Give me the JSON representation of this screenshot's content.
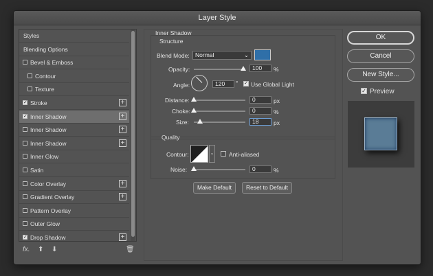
{
  "dialog": {
    "title": "Layer Style"
  },
  "sidebar": {
    "items": [
      {
        "label": "Styles",
        "checkbox": false,
        "checked": false,
        "plus": false,
        "indent": false,
        "selected": false
      },
      {
        "label": "Blending Options",
        "checkbox": false,
        "checked": false,
        "plus": false,
        "indent": false,
        "selected": false
      },
      {
        "label": "Bevel & Emboss",
        "checkbox": true,
        "checked": false,
        "plus": false,
        "indent": false,
        "selected": false
      },
      {
        "label": "Contour",
        "checkbox": true,
        "checked": false,
        "plus": false,
        "indent": true,
        "selected": false
      },
      {
        "label": "Texture",
        "checkbox": true,
        "checked": false,
        "plus": false,
        "indent": true,
        "selected": false
      },
      {
        "label": "Stroke",
        "checkbox": true,
        "checked": true,
        "plus": true,
        "indent": false,
        "selected": false
      },
      {
        "label": "Inner Shadow",
        "checkbox": true,
        "checked": true,
        "plus": true,
        "indent": false,
        "selected": true
      },
      {
        "label": "Inner Shadow",
        "checkbox": true,
        "checked": false,
        "plus": true,
        "indent": false,
        "selected": false
      },
      {
        "label": "Inner Shadow",
        "checkbox": true,
        "checked": false,
        "plus": true,
        "indent": false,
        "selected": false
      },
      {
        "label": "Inner Glow",
        "checkbox": true,
        "checked": false,
        "plus": false,
        "indent": false,
        "selected": false
      },
      {
        "label": "Satin",
        "checkbox": true,
        "checked": false,
        "plus": false,
        "indent": false,
        "selected": false
      },
      {
        "label": "Color Overlay",
        "checkbox": true,
        "checked": false,
        "plus": true,
        "indent": false,
        "selected": false
      },
      {
        "label": "Gradient Overlay",
        "checkbox": true,
        "checked": false,
        "plus": true,
        "indent": false,
        "selected": false
      },
      {
        "label": "Pattern Overlay",
        "checkbox": true,
        "checked": false,
        "plus": false,
        "indent": false,
        "selected": false
      },
      {
        "label": "Outer Glow",
        "checkbox": true,
        "checked": false,
        "plus": false,
        "indent": false,
        "selected": false
      },
      {
        "label": "Drop Shadow",
        "checkbox": true,
        "checked": true,
        "plus": true,
        "indent": false,
        "selected": false
      }
    ],
    "footer": {
      "fx_label": "fx."
    }
  },
  "section": {
    "title": "Inner Shadow",
    "structure_title": "Structure",
    "blend_mode_label": "Blend Mode:",
    "blend_mode_value": "Normal",
    "shadow_color": "#2f6fa8",
    "opacity_label": "Opacity:",
    "opacity_value": "100",
    "angle_label": "Angle:",
    "angle_value": "120",
    "angle_unit": "°",
    "use_global_light_label": "Use Global Light",
    "distance_label": "Distance:",
    "distance_value": "0",
    "choke_label": "Choke:",
    "choke_value": "0",
    "size_label": "Size:",
    "size_value": "18",
    "unit_px": "px",
    "unit_pct": "%",
    "quality_title": "Quality",
    "contour_label": "Contour:",
    "anti_aliased_label": "Anti-aliased",
    "noise_label": "Noise:",
    "noise_value": "0",
    "make_default_label": "Make Default",
    "reset_default_label": "Reset to Default"
  },
  "buttons": {
    "ok": "OK",
    "cancel": "Cancel",
    "new_style": "New Style...",
    "preview_label": "Preview"
  },
  "colors": {
    "accent": "#6da0d8",
    "preview_swatch": "#5a7c96"
  }
}
